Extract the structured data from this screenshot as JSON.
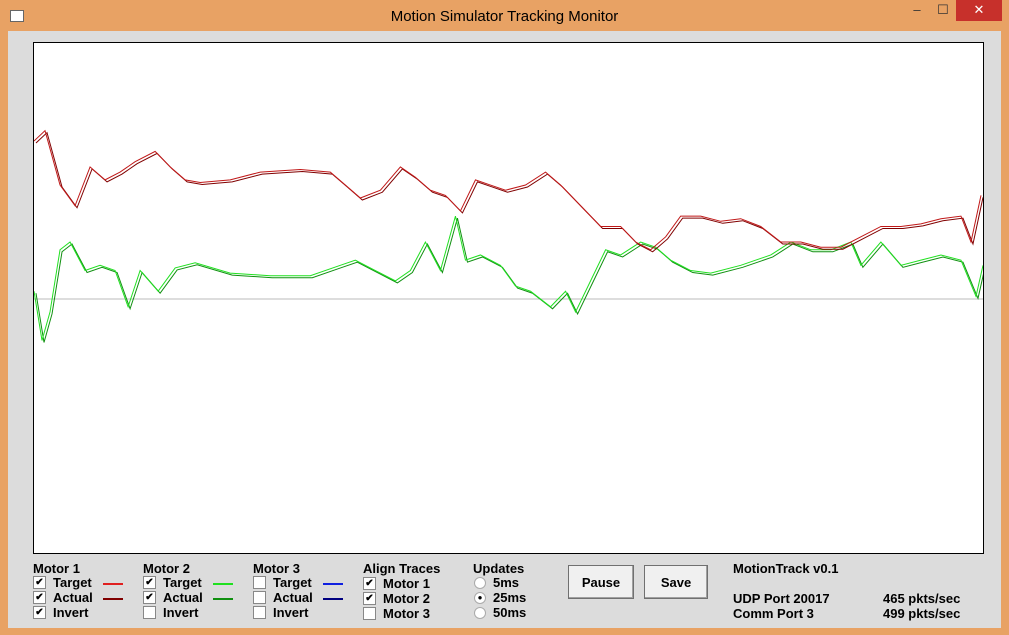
{
  "window": {
    "title": "Motion Simulator Tracking Monitor",
    "minimize": "–",
    "maximize": "☐",
    "close": "✕"
  },
  "motor1": {
    "label": "Motor 1",
    "target": "Target",
    "actual": "Actual",
    "invert": "Invert",
    "target_checked": true,
    "actual_checked": true,
    "invert_checked": true,
    "target_color": "#e02020",
    "actual_color": "#800000"
  },
  "motor2": {
    "label": "Motor 2",
    "target": "Target",
    "actual": "Actual",
    "invert": "Invert",
    "target_checked": true,
    "actual_checked": true,
    "invert_checked": false,
    "target_color": "#20e020",
    "actual_color": "#109010"
  },
  "motor3": {
    "label": "Motor 3",
    "target": "Target",
    "actual": "Actual",
    "invert": "Invert",
    "target_checked": false,
    "actual_checked": false,
    "invert_checked": false,
    "target_color": "#1020e0",
    "actual_color": "#000080"
  },
  "align": {
    "label": "Align Traces",
    "items": [
      {
        "label": "Motor 1",
        "checked": true
      },
      {
        "label": "Motor 2",
        "checked": true
      },
      {
        "label": "Motor 3",
        "checked": false
      }
    ]
  },
  "updates": {
    "label": "Updates",
    "options": [
      {
        "label": "5ms",
        "selected": false
      },
      {
        "label": "25ms",
        "selected": true
      },
      {
        "label": "50ms",
        "selected": false
      }
    ]
  },
  "buttons": {
    "pause": "Pause",
    "save": "Save"
  },
  "info": {
    "version": "MotionTrack v0.1",
    "udp": "UDP Port 20017",
    "udp_rate": "465 pkts/sec",
    "comm": "Comm Port 3",
    "comm_rate": "499 pkts/sec"
  },
  "chart_data": {
    "type": "line",
    "ylim": [
      -1,
      1
    ],
    "xlim": [
      0,
      948
    ],
    "zero_line": true,
    "t": [
      0,
      11,
      26,
      41,
      56,
      71,
      86,
      101,
      121,
      136,
      151,
      166,
      196,
      226,
      266,
      296,
      311,
      326,
      346,
      366,
      381,
      396,
      411,
      426,
      441,
      456,
      471,
      491,
      511,
      526,
      546,
      566,
      586,
      601,
      616,
      631,
      646,
      666,
      686,
      706,
      726,
      746,
      766,
      786,
      806,
      826,
      846,
      866,
      886,
      906,
      926,
      936,
      946
    ],
    "motor1_target": [
      0.61,
      0.65,
      0.44,
      0.36,
      0.51,
      0.46,
      0.49,
      0.53,
      0.57,
      0.51,
      0.46,
      0.45,
      0.46,
      0.49,
      0.5,
      0.49,
      0.44,
      0.39,
      0.42,
      0.51,
      0.47,
      0.42,
      0.4,
      0.34,
      0.46,
      0.44,
      0.42,
      0.44,
      0.49,
      0.44,
      0.36,
      0.28,
      0.28,
      0.22,
      0.19,
      0.24,
      0.32,
      0.32,
      0.3,
      0.31,
      0.28,
      0.22,
      0.22,
      0.2,
      0.2,
      0.24,
      0.28,
      0.28,
      0.29,
      0.31,
      0.32,
      0.22,
      0.4
    ],
    "t2": [
      0,
      8,
      16,
      26,
      36,
      51,
      66,
      81,
      94,
      106,
      124,
      141,
      161,
      196,
      236,
      276,
      306,
      321,
      341,
      361,
      376,
      391,
      406,
      421,
      431,
      446,
      466,
      481,
      496,
      516,
      531,
      541,
      556,
      571,
      586,
      606,
      621,
      636,
      656,
      676,
      706,
      736,
      756,
      776,
      796,
      816,
      826,
      846,
      866,
      886,
      906,
      926,
      941,
      948
    ],
    "motor2_target": [
      0.03,
      -0.16,
      -0.05,
      0.19,
      0.22,
      0.11,
      0.13,
      0.11,
      -0.03,
      0.11,
      0.03,
      0.12,
      0.14,
      0.1,
      0.09,
      0.09,
      0.13,
      0.15,
      0.11,
      0.07,
      0.11,
      0.22,
      0.11,
      0.32,
      0.15,
      0.17,
      0.13,
      0.05,
      0.03,
      -0.03,
      0.03,
      -0.05,
      0.07,
      0.19,
      0.17,
      0.22,
      0.2,
      0.15,
      0.11,
      0.1,
      0.13,
      0.17,
      0.22,
      0.19,
      0.19,
      0.22,
      0.13,
      0.22,
      0.13,
      0.15,
      0.17,
      0.15,
      0.01,
      0.13
    ]
  }
}
